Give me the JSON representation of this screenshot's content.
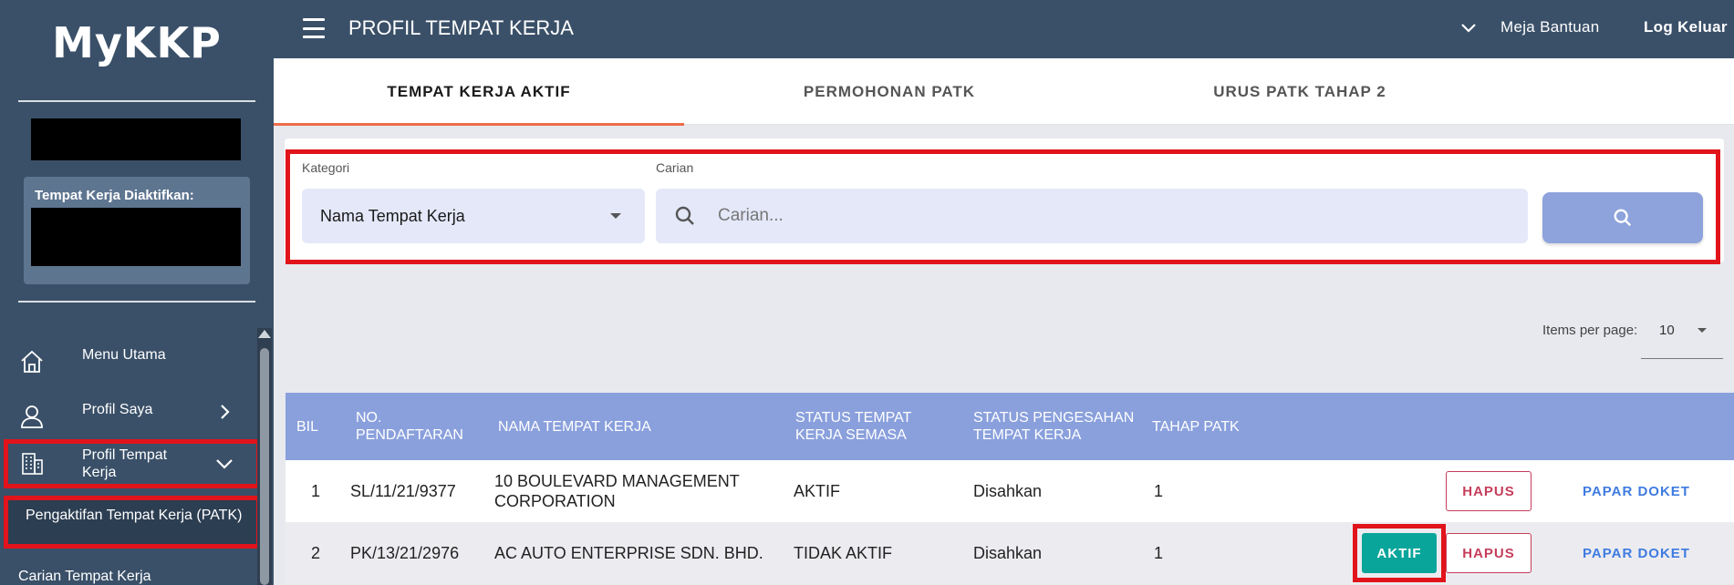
{
  "app": {
    "logo": "MyKKP"
  },
  "sidebar": {
    "active_card_label": "Tempat Kerja Diaktifkan:",
    "items": [
      {
        "label": "Menu Utama",
        "icon": "home-icon"
      },
      {
        "label": "Profil Saya",
        "icon": "person-icon"
      },
      {
        "label": "Profil Tempat Kerja",
        "icon": "building-icon"
      }
    ],
    "submenu_item": "Pengaktifan Tempat Kerja (PATK)",
    "bottom_item": "Carian Tempat Kerja"
  },
  "header": {
    "title": "PROFIL TEMPAT KERJA",
    "help": "Meja Bantuan",
    "logout": "Log Keluar"
  },
  "tabs": [
    {
      "label": "TEMPAT KERJA AKTIF",
      "active": true
    },
    {
      "label": "PERMOHONAN PATK",
      "active": false
    },
    {
      "label": "URUS PATK TAHAP 2",
      "active": false
    }
  ],
  "filter": {
    "category_label": "Kategori",
    "category_value": "Nama Tempat Kerja",
    "search_label": "Carian",
    "search_placeholder": "Carian..."
  },
  "paginator": {
    "label": "Items per page:",
    "value": "10"
  },
  "table": {
    "headers": {
      "bil": "BIL",
      "no": "NO. PENDAFTARAN",
      "nama": "NAMA TEMPAT KERJA",
      "status": "STATUS TEMPAT KERJA SEMASA",
      "pengesahan": "STATUS PENGESAHAN TEMPAT KERJA",
      "tahap": "TAHAP PATK"
    },
    "rows": [
      {
        "bil": "1",
        "no": "SL/11/21/9377",
        "nama": "10 BOULEVARD MANAGEMENT CORPORATION",
        "status": "AKTIF",
        "pengesahan": "Disahkan",
        "tahap": "1",
        "show_aktif": false
      },
      {
        "bil": "2",
        "no": "PK/13/21/2976",
        "nama": "AC AUTO ENTERPRISE SDN. BHD.",
        "status": "TIDAK AKTIF",
        "pengesahan": "Disahkan",
        "tahap": "1",
        "show_aktif": true
      }
    ],
    "actions": {
      "aktif": "AKTIF",
      "hapus": "HAPUS",
      "papar": "PAPAR DOKET"
    }
  },
  "colors": {
    "sidebar": "#3a5068",
    "table_header": "#8aa0dc",
    "tab_ink": "#ef6c4a",
    "aktif_button": "#0aa59a",
    "hapus": "#c63d5b",
    "papar": "#3f7be0",
    "highlight": "#e1141b"
  }
}
